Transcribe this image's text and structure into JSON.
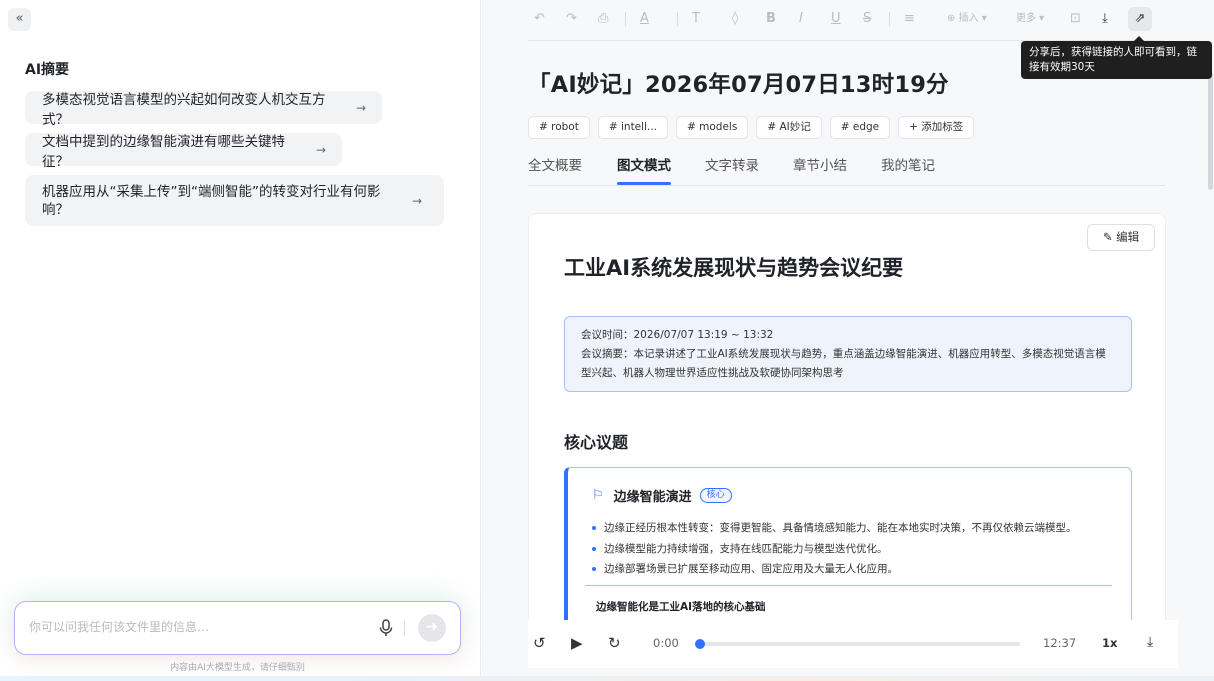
{
  "left": {
    "collapse_label": "«",
    "title": "AI摘要",
    "suggestions": [
      "多模态视觉语言模型的兴起如何改变人机交互方式？",
      "文档中提到的边缘智能演进有哪些关键特征？",
      "机器应用从“采集上传”到“端侧智能”的转变对行业有何影响？"
    ],
    "arrow": "→",
    "chat_placeholder": "你可以问我任何该文件里的信息…",
    "disclaimer": "内容由AI大模型生成，请仔细甄别"
  },
  "toolbar": {
    "undo": "↶",
    "redo": "↷",
    "save": "⎙",
    "font_color": "A",
    "text_style": "T",
    "highlight": "◊",
    "bold": "B",
    "italic": "I",
    "underline": "U",
    "strike": "S",
    "align": "≡",
    "insert": "⊕ 插入 ▾",
    "more": "更多 ▾",
    "format": "⊡",
    "download": "⤓",
    "share": "⇗"
  },
  "tooltip": "分享后，获得链接的人即可看到，链接有效期30天",
  "doc": {
    "title": "「AI妙记」2026年07月07日13时19分",
    "tags": [
      "# robot",
      "# intell...",
      "# models",
      "# AI妙记",
      "# edge",
      "+ 添加标签"
    ],
    "tabs": [
      "全文概要",
      "图文模式",
      "文字转录",
      "章节小结",
      "我的笔记"
    ],
    "active_tab": "图文模式"
  },
  "card": {
    "edit_label": "✎ 编辑",
    "heading": "工业AI系统发展现状与趋势会议纪要",
    "meeting_time": "会议时间：2026/07/07 13:19 ~ 13:32",
    "meeting_summary": "会议摘要：本记录讲述了工业AI系统发展现状与趋势，重点涵盖边缘智能演进、机器应用转型、多模态视觉语言模型兴起、机器人物理世界适应性挑战及软硬协同架构思考",
    "section_title": "核心议题",
    "topic": {
      "title": "边缘智能演进",
      "badge": "核心",
      "bullets": [
        "边缘正经历根本性转变：变得更智能、具备情境感知能力、能在本地实时决策，不再仅依赖云端模型。",
        "边缘模型能力持续增强，支持在线匹配能力与模型迭代优化。",
        "边缘部署场景已扩展至移动应用、固定应用及大量无人化应用。"
      ],
      "subheading": "边缘智能化是工业AI落地的核心基础"
    }
  },
  "player": {
    "rewind": "↺",
    "play": "▶",
    "forward": "↻",
    "current_time": "0:00",
    "total_time": "12:37",
    "speed": "1x",
    "download": "⤓",
    "progress": 0
  }
}
